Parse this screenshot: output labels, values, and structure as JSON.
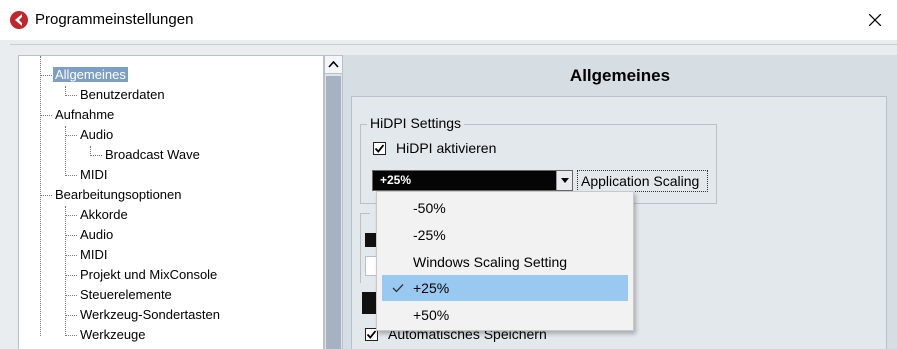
{
  "window": {
    "title": "Programmeinstellungen",
    "icon": "cubase-logo-icon",
    "close_icon": "close-icon"
  },
  "tree": {
    "items": [
      {
        "label": "Allgemeines",
        "level": 0,
        "selected": true
      },
      {
        "label": "Benutzerdaten",
        "level": 1
      },
      {
        "label": "Aufnahme",
        "level": 0
      },
      {
        "label": "Audio",
        "level": 1
      },
      {
        "label": "Broadcast Wave",
        "level": 2
      },
      {
        "label": "MIDI",
        "level": 1
      },
      {
        "label": "Bearbeitungsoptionen",
        "level": 0
      },
      {
        "label": "Akkorde",
        "level": 1
      },
      {
        "label": "Audio",
        "level": 1
      },
      {
        "label": "MIDI",
        "level": 1
      },
      {
        "label": "Projekt und MixConsole",
        "level": 1
      },
      {
        "label": "Steuerelemente",
        "level": 1
      },
      {
        "label": "Werkzeug-Sondertasten",
        "level": 1
      },
      {
        "label": "Werkzeuge",
        "level": 1
      }
    ]
  },
  "main": {
    "title": "Allgemeines",
    "hidpi": {
      "group_label": "HiDPI Settings",
      "checkbox_label": "HiDPI aktivieren",
      "checked": true,
      "scaling_value": "+25%",
      "scaling_button": "Application Scaling"
    },
    "autosave": {
      "label": "Automatisches Speichern",
      "checked": true
    }
  },
  "dropdown": {
    "options": [
      {
        "label": "-50%",
        "selected": false
      },
      {
        "label": "-25%",
        "selected": false
      },
      {
        "label": "Windows Scaling Setting",
        "selected": false
      },
      {
        "label": "+25%",
        "selected": true
      },
      {
        "label": "+50%",
        "selected": false
      }
    ]
  },
  "colors": {
    "selection": "#7e9fc4",
    "dropdown_highlight": "#99c9f1",
    "panel_bg": "#d6dde3"
  }
}
